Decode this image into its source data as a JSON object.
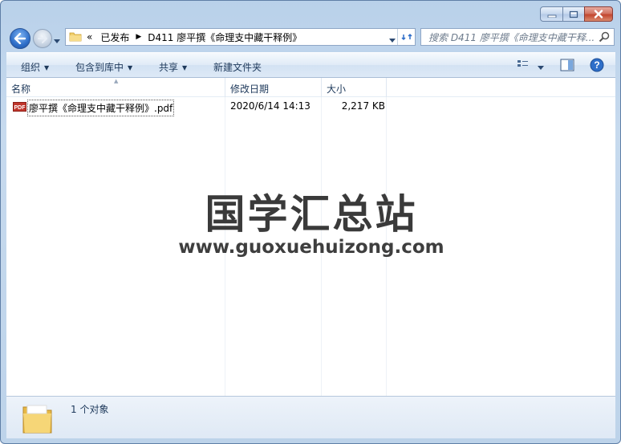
{
  "window": {
    "caption_buttons": [
      "minimize",
      "maximize",
      "close"
    ]
  },
  "address_bar": {
    "overflow": "«",
    "crumbs": [
      "已发布",
      "D411 廖平撰《命理支中藏干释例》"
    ]
  },
  "search": {
    "placeholder": "搜索 D411 廖平撰《命理支中藏干释..."
  },
  "toolbar": {
    "organize": "组织",
    "include_in_library": "包含到库中",
    "share": "共享",
    "new_folder": "新建文件夹"
  },
  "columns": {
    "name": "名称",
    "date_modified": "修改日期",
    "size": "大小"
  },
  "files": [
    {
      "name": "廖平撰《命理支中藏干释例》.pdf",
      "date": "2020/6/14 14:13",
      "size": "2,217 KB",
      "icon": "pdf-icon"
    }
  ],
  "watermark": {
    "title": "国学汇总站",
    "url": "www.guoxuehuizong.com"
  },
  "details": {
    "count": "1 个对象"
  },
  "colors": {
    "frame": "#bdd3ea",
    "toolbar_text": "#1e395b",
    "accent_blue": "#2f6fc9"
  }
}
